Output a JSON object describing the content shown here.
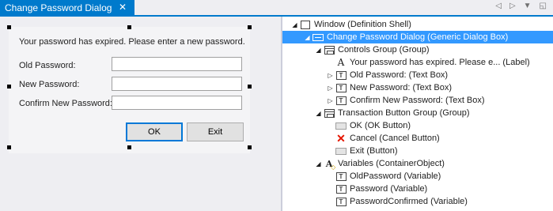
{
  "tab": {
    "title": "Change Password Dialog",
    "close_glyph": "✕"
  },
  "strip_buttons": [
    "◁",
    "▷",
    "▼",
    "◱"
  ],
  "dialog": {
    "message": "Your password has expired. Please enter a new password.",
    "fields": [
      {
        "label": "Old Password:",
        "value": ""
      },
      {
        "label": "New Password:",
        "value": ""
      },
      {
        "label": "Confirm New Password:",
        "value": ""
      }
    ],
    "ok_label": "OK",
    "exit_label": "Exit"
  },
  "tree": {
    "window": "Window (Definition Shell)",
    "dialog": "Change Password Dialog (Generic Dialog Box)",
    "controls_group": "Controls Group (Group)",
    "label": "Your password has expired. Please e... (Label)",
    "old_pw": "Old Password: (Text Box)",
    "new_pw": "New Password: (Text Box)",
    "confirm_pw": "Confirm New Password: (Text Box)",
    "transaction_group": "Transaction Button Group (Group)",
    "ok_button": "OK (OK Button)",
    "cancel_button": "Cancel (Cancel Button)",
    "exit_button": "Exit (Button)",
    "variables": "Variables (ContainerObject)",
    "var_old": "OldPassword (Variable)",
    "var_pw": "Password (Variable)",
    "var_confirmed": "PasswordConfirmed (Variable)",
    "box_glyph": "T",
    "label_glyph": "A",
    "cancel_glyph": "✕",
    "vars_glyph": "A",
    "vars_sub_glyph": "◇"
  },
  "colors": {
    "accent": "#007acc",
    "selection": "#3399ff",
    "cancel": "#e51400"
  },
  "icons": {
    "textbox": "textbox-icon",
    "group": "group-icon",
    "label": "label-icon",
    "button": "button-icon",
    "cancel": "cancel-icon",
    "variables": "variables-icon"
  }
}
